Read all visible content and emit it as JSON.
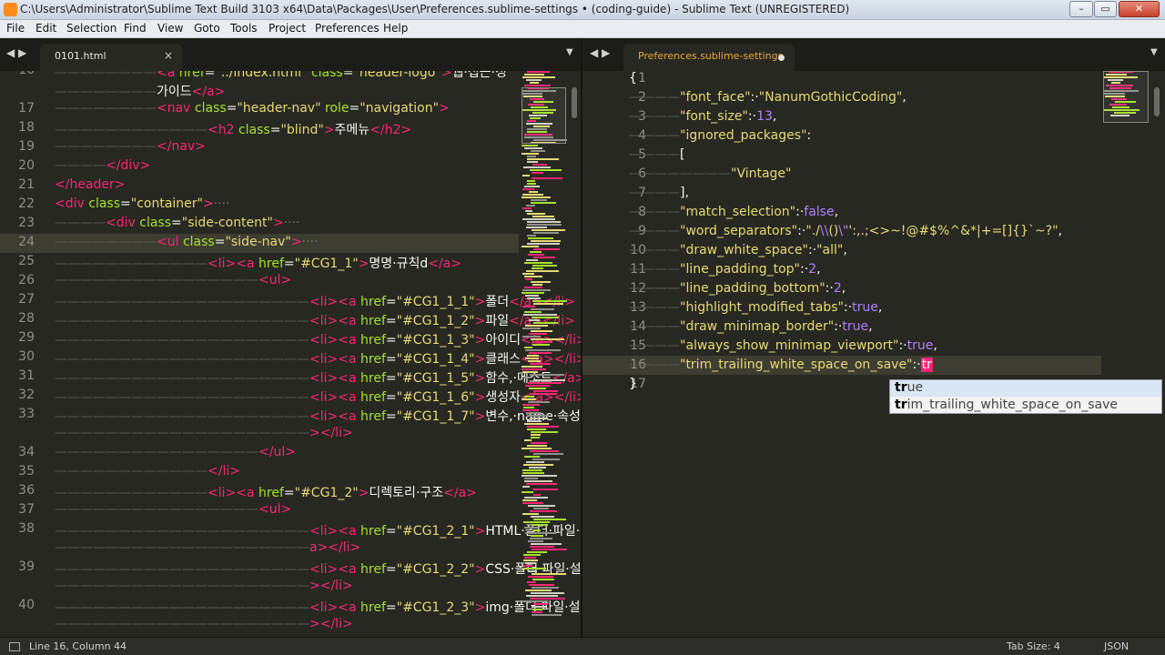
{
  "window": {
    "title": "C:\\Users\\Administrator\\Sublime Text Build 3103 x64\\Data\\Packages\\User\\Preferences.sublime-settings • (coding-guide) - Sublime Text (UNREGISTERED)",
    "minimize": "–",
    "maximize": "▭",
    "close": "✕"
  },
  "menu": [
    "File",
    "Edit",
    "Selection",
    "Find",
    "View",
    "Goto",
    "Tools",
    "Project",
    "Preferences",
    "Help"
  ],
  "left_pane": {
    "tab_label": "0101.html",
    "tab_close": "×",
    "arrows": "◀ ▶",
    "pane_menu": "▼",
    "lines": [
      {
        "num": "16",
        "html": "<span class=\"ws\">————————</span><span class=\"tag\">&lt;a</span> <span class=\"attr\">href</span>=<span class=\"str\">\"../index.html\"</span> <span class=\"attr\">class</span>=<span class=\"str\">\"header-logo\"</span><span class=\"tag\">&gt;</span>웹·접근·성"
      },
      {
        "num": "",
        "html": "<span class=\"ws\">————————</span>가이드<span class=\"tag\">&lt;/a&gt;</span>"
      },
      {
        "num": "17",
        "html": "<span class=\"ws\">————————</span><span class=\"tag\">&lt;nav</span> <span class=\"attr\">class</span>=<span class=\"str\">\"header-nav\"</span> <span class=\"attr\">role</span>=<span class=\"str\">\"navigation\"</span><span class=\"tag\">&gt;</span>"
      },
      {
        "num": "18",
        "html": "<span class=\"ws\">————————————</span><span class=\"tag\">&lt;h2</span> <span class=\"attr\">class</span>=<span class=\"str\">\"blind\"</span><span class=\"tag\">&gt;</span>주메뉴<span class=\"tag\">&lt;/h2&gt;</span>"
      },
      {
        "num": "19",
        "html": "<span class=\"ws\">————————</span><span class=\"tag\">&lt;/nav&gt;</span>"
      },
      {
        "num": "20",
        "html": "<span class=\"ws\">————</span><span class=\"tag\">&lt;/div&gt;</span>"
      },
      {
        "num": "21",
        "html": "<span class=\"tag\">&lt;/header&gt;</span>"
      },
      {
        "num": "22",
        "html": "<span class=\"tag\">&lt;div</span> <span class=\"attr\">class</span>=<span class=\"str\">\"container\"</span><span class=\"tag\">&gt;</span><span class=\"fold\">····</span>"
      },
      {
        "num": "23",
        "html": "<span class=\"ws\">————</span><span class=\"tag\">&lt;div</span> <span class=\"attr\">class</span>=<span class=\"str\">\"side-content\"</span><span class=\"tag\">&gt;</span><span class=\"fold\">····</span>"
      },
      {
        "num": "24",
        "html": "<span class=\"ws\">————————</span><span class=\"tag\">&lt;ul</span> <span class=\"attr\">class</span>=<span class=\"str\">\"side-nav\"</span><span class=\"tag\">&gt;</span><span class=\"fold\">····</span>"
      },
      {
        "num": "25",
        "html": "<span class=\"ws\">————————————</span><span class=\"tag\">&lt;li&gt;&lt;a</span> <span class=\"attr\">href</span>=<span class=\"str\">\"#CG1_1\"</span><span class=\"tag\">&gt;</span>명명·규칙d<span class=\"tag\">&lt;/a&gt;</span>"
      },
      {
        "num": "26",
        "html": "<span class=\"ws\">————————————————</span><span class=\"tag\">&lt;ul&gt;</span>"
      },
      {
        "num": "27",
        "html": "<span class=\"ws\">————————————————————</span><span class=\"tag\">&lt;li&gt;&lt;a</span> <span class=\"attr\">href</span>=<span class=\"str\">\"#CG1_1_1\"</span><span class=\"tag\">&gt;</span>폴더<span class=\"tag\">&lt;/a&gt;&lt;/li&gt;</span>"
      },
      {
        "num": "28",
        "html": "<span class=\"ws\">————————————————————</span><span class=\"tag\">&lt;li&gt;&lt;a</span> <span class=\"attr\">href</span>=<span class=\"str\">\"#CG1_1_2\"</span><span class=\"tag\">&gt;</span>파일<span class=\"tag\">&lt;/a&gt;&lt;/li&gt;</span>"
      },
      {
        "num": "29",
        "html": "<span class=\"ws\">————————————————————</span><span class=\"tag\">&lt;li&gt;&lt;a</span> <span class=\"attr\">href</span>=<span class=\"str\">\"#CG1_1_3\"</span><span class=\"tag\">&gt;</span>아이디<span class=\"tag\">&lt;/a&gt;&lt;/li&gt;</span>"
      },
      {
        "num": "30",
        "html": "<span class=\"ws\">————————————————————</span><span class=\"tag\">&lt;li&gt;&lt;a</span> <span class=\"attr\">href</span>=<span class=\"str\">\"#CG1_1_4\"</span><span class=\"tag\">&gt;</span>클래스<span class=\"tag\">&lt;/a&gt;&lt;/li&gt;</span>"
      },
      {
        "num": "31",
        "html": "<span class=\"ws\">————————————————————</span><span class=\"tag\">&lt;li&gt;&lt;a</span> <span class=\"attr\">href</span>=<span class=\"str\">\"#CG1_1_5\"</span><span class=\"tag\">&gt;</span>함수,·메소드<span class=\"tag\">&lt;/a&gt;&lt;/li&gt;</span>"
      },
      {
        "num": "32",
        "html": "<span class=\"ws\">————————————————————</span><span class=\"tag\">&lt;li&gt;&lt;a</span> <span class=\"attr\">href</span>=<span class=\"str\">\"#CG1_1_6\"</span><span class=\"tag\">&gt;</span>생성자<span class=\"tag\">&lt;/a&gt;&lt;/li&gt;</span>"
      },
      {
        "num": "33",
        "html": "<span class=\"ws\">————————————————————</span><span class=\"tag\">&lt;li&gt;&lt;a</span> <span class=\"attr\">href</span>=<span class=\"str\">\"#CG1_1_7\"</span><span class=\"tag\">&gt;</span>변수,·name·속성·값<span class=\"tag\">&lt;/a</span>"
      },
      {
        "num": "",
        "html": "<span class=\"ws\">————————————————————</span><span class=\"tag\">&gt;&lt;/li&gt;</span>"
      },
      {
        "num": "34",
        "html": "<span class=\"ws\">————————————————</span><span class=\"tag\">&lt;/ul&gt;</span>"
      },
      {
        "num": "35",
        "html": "<span class=\"ws\">————————————</span><span class=\"tag\">&lt;/li&gt;</span>"
      },
      {
        "num": "36",
        "html": "<span class=\"ws\">————————————</span><span class=\"tag\">&lt;li&gt;&lt;a</span> <span class=\"attr\">href</span>=<span class=\"str\">\"#CG1_2\"</span><span class=\"tag\">&gt;</span>디렉토리·구조<span class=\"tag\">&lt;/a&gt;</span>"
      },
      {
        "num": "37",
        "html": "<span class=\"ws\">————————————————</span><span class=\"tag\">&lt;ul&gt;</span>"
      },
      {
        "num": "38",
        "html": "<span class=\"ws\">————————————————————</span><span class=\"tag\">&lt;li&gt;&lt;a</span> <span class=\"attr\">href</span>=<span class=\"str\">\"#CG1_2_1\"</span><span class=\"tag\">&gt;</span>HTML·폴더·파일·설명<span class=\"tag\">&lt;/</span>"
      },
      {
        "num": "",
        "html": "<span class=\"ws\">————————————————————</span><span class=\"tag\">a&gt;&lt;/li&gt;</span>"
      },
      {
        "num": "39",
        "html": "<span class=\"ws\">————————————————————</span><span class=\"tag\">&lt;li&gt;&lt;a</span> <span class=\"attr\">href</span>=<span class=\"str\">\"#CG1_2_2\"</span><span class=\"tag\">&gt;</span>CSS·폴더·파일·설명<span class=\"tag\">&lt;/a</span>"
      },
      {
        "num": "",
        "html": "<span class=\"ws\">————————————————————</span><span class=\"tag\">&gt;&lt;/li&gt;</span>"
      },
      {
        "num": "40",
        "html": "<span class=\"ws\">————————————————————</span><span class=\"tag\">&lt;li&gt;&lt;a</span> <span class=\"attr\">href</span>=<span class=\"str\">\"#CG1_2_3\"</span><span class=\"tag\">&gt;</span>img·폴더·파일·설명<span class=\"tag\">&lt;/a</span>"
      },
      {
        "num": "",
        "html": "<span class=\"ws\">————————————————————</span><span class=\"tag\">&gt;&lt;/li&gt;</span>"
      }
    ]
  },
  "right_pane": {
    "tab_label": "Preferences.sublime-settings",
    "arrows": "◀ ▶",
    "pane_menu": "▼",
    "lines": [
      {
        "num": "1",
        "html": "{"
      },
      {
        "num": "2",
        "html": "<span class=\"ws\">————</span><span class=\"str\">\"font_face\"</span>:·<span class=\"str\">\"NanumGothicCoding\"</span>,"
      },
      {
        "num": "3",
        "html": "<span class=\"ws\">————</span><span class=\"str\">\"font_size\"</span>:·<span class=\"num\">13</span>,"
      },
      {
        "num": "4",
        "html": "<span class=\"ws\">————</span><span class=\"str\">\"ignored_packages\"</span>:"
      },
      {
        "num": "5",
        "html": "<span class=\"ws\">————</span>["
      },
      {
        "num": "6",
        "html": "<span class=\"ws\">————————</span><span class=\"str\">\"Vintage\"</span>"
      },
      {
        "num": "7",
        "html": "<span class=\"ws\">————</span>],"
      },
      {
        "num": "8",
        "html": "<span class=\"ws\">————</span><span class=\"str\">\"match_selection\"</span>:·<span class=\"kw\">false</span>,"
      },
      {
        "num": "9",
        "html": "<span class=\"ws\">————</span><span class=\"str\">\"word_separators\"</span>:·<span class=\"str\">\"./</span><span class=\"num\">\\\\</span><span class=\"str\">()</span><span class=\"num\">\\\"</span><span class=\"str\">':,.;&lt;&gt;~!@#$%^&amp;*|+=[]{}`~?\"</span>,"
      },
      {
        "num": "10",
        "html": "<span class=\"ws\">————</span><span class=\"str\">\"draw_white_space\"</span>:·<span class=\"str\">\"all\"</span>,"
      },
      {
        "num": "11",
        "html": "<span class=\"ws\">————</span><span class=\"str\">\"line_padding_top\"</span>:·<span class=\"num\">2</span>,"
      },
      {
        "num": "12",
        "html": "<span class=\"ws\">————</span><span class=\"str\">\"line_padding_bottom\"</span>:·<span class=\"num\">2</span>,"
      },
      {
        "num": "13",
        "html": "<span class=\"ws\">————</span><span class=\"str\">\"highlight_modified_tabs\"</span>:·<span class=\"kw\">true</span>,"
      },
      {
        "num": "14",
        "html": "<span class=\"ws\">————</span><span class=\"str\">\"draw_minimap_border\"</span>:·<span class=\"kw\">true</span>,"
      },
      {
        "num": "15",
        "html": "<span class=\"ws\">————</span><span class=\"str\">\"always_show_minimap_viewport\"</span>:·<span class=\"kw\">true</span>,"
      },
      {
        "num": "16",
        "html": "<span class=\"ws\">————</span><span class=\"str\">\"trim_trailing_white_space_on_save\"</span>:·<span id=\"typed-word\">tr</span>"
      },
      {
        "num": "17",
        "html": "}"
      }
    ]
  },
  "autocomplete": {
    "items": [
      {
        "match": "tr",
        "rest": "ue"
      },
      {
        "match": "tr",
        "rest": "im_trailing_white_space_on_save"
      }
    ]
  },
  "status": {
    "position": "Line 16, Column 44",
    "tab_size": "Tab Size: 4",
    "syntax": "JSON"
  },
  "colors": {
    "background": "#272822",
    "tag": "#f92672",
    "attribute": "#a6e22e",
    "string": "#e6db74",
    "number": "#ae81ff"
  }
}
